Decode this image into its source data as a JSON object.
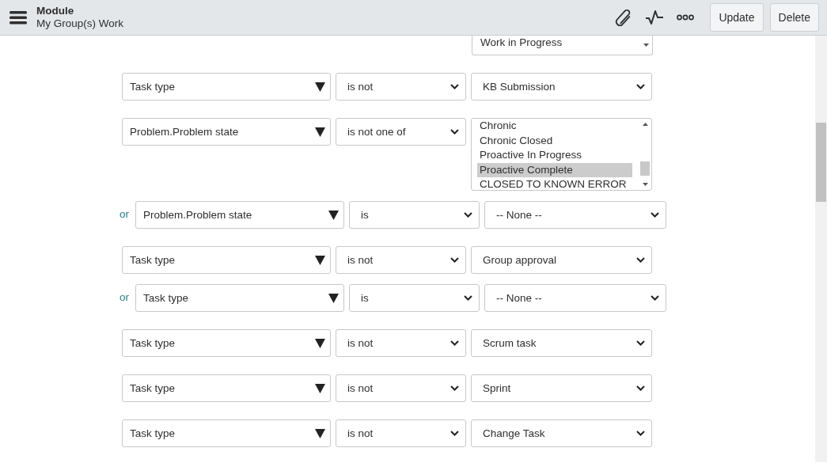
{
  "header": {
    "title": "Module",
    "subtitle": "My Group(s) Work",
    "buttons": [
      "Update",
      "Delete"
    ]
  },
  "top_listbox": {
    "options": [
      {
        "label": "Work in Progress",
        "selected": false
      }
    ]
  },
  "conditions": [
    {
      "field": "Task type",
      "operator": "is not",
      "value": {
        "kind": "select",
        "text": "KB Submission"
      }
    },
    {
      "field": "Problem.Problem state",
      "operator": "is not one of",
      "value": {
        "kind": "listbox",
        "options": [
          {
            "label": "Chronic",
            "selected": false
          },
          {
            "label": "Chronic Closed",
            "selected": false
          },
          {
            "label": "Proactive In Progress",
            "selected": false
          },
          {
            "label": "Proactive Complete",
            "selected": true
          },
          {
            "label": "CLOSED TO KNOWN ERROR",
            "selected": false
          }
        ]
      }
    },
    {
      "connector": "or",
      "field": "Problem.Problem state",
      "operator": "is",
      "value": {
        "kind": "select",
        "text": "-- None --"
      }
    },
    {
      "field": "Task type",
      "operator": "is not",
      "value": {
        "kind": "select",
        "text": "Group approval"
      }
    },
    {
      "connector": "or",
      "field": "Task type",
      "operator": "is",
      "value": {
        "kind": "select",
        "text": "-- None --"
      }
    },
    {
      "field": "Task type",
      "operator": "is not",
      "value": {
        "kind": "select",
        "text": "Scrum task"
      }
    },
    {
      "field": "Task type",
      "operator": "is not",
      "value": {
        "kind": "select",
        "text": "Sprint"
      }
    },
    {
      "field": "Task type",
      "operator": "is not",
      "value": {
        "kind": "select",
        "text": "Change Task"
      }
    }
  ]
}
